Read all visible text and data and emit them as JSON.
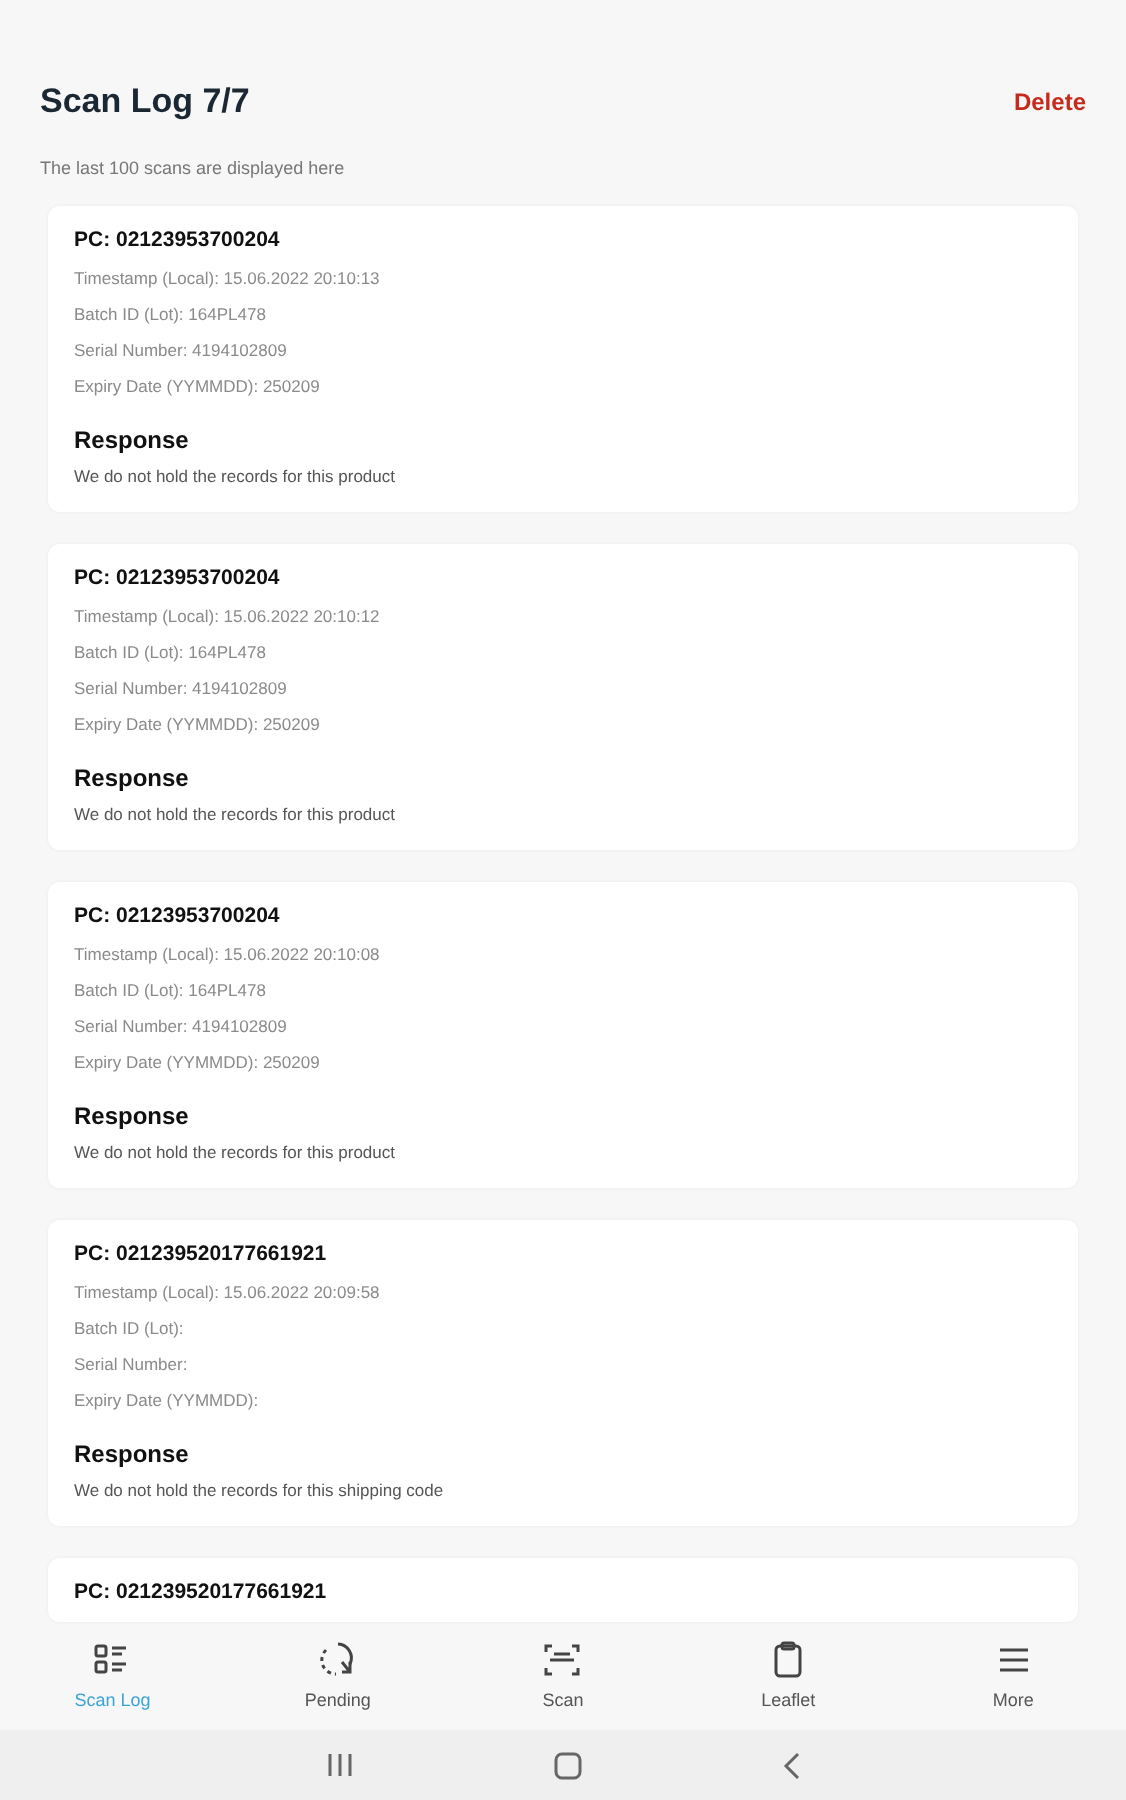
{
  "header": {
    "title": "Scan Log 7/7",
    "action": "Delete",
    "subtitle": "The last 100 scans are displayed here"
  },
  "scans": [
    {
      "pc": "PC: 02123953700204",
      "fields": [
        "Timestamp (Local): 15.06.2022 20:10:13",
        "Batch ID (Lot): 164PL478",
        "Serial Number: 4194102809",
        "Expiry Date (YYMMDD): 250209"
      ],
      "response_title": "Response",
      "response": "We do not hold the records for this product"
    },
    {
      "pc": "PC: 02123953700204",
      "fields": [
        "Timestamp (Local): 15.06.2022 20:10:12",
        "Batch ID (Lot): 164PL478",
        "Serial Number: 4194102809",
        "Expiry Date (YYMMDD): 250209"
      ],
      "response_title": "Response",
      "response": "We do not hold the records for this product"
    },
    {
      "pc": "PC: 02123953700204",
      "fields": [
        "Timestamp (Local): 15.06.2022 20:10:08",
        "Batch ID (Lot): 164PL478",
        "Serial Number: 4194102809",
        "Expiry Date (YYMMDD): 250209"
      ],
      "response_title": "Response",
      "response": "We do not hold the records for this product"
    },
    {
      "pc": "PC: 021239520177661921",
      "fields": [
        "Timestamp (Local): 15.06.2022 20:09:58",
        "Batch ID (Lot):",
        "Serial Number:",
        "Expiry Date (YYMMDD):"
      ],
      "response_title": "Response",
      "response": "We do not hold the records for this shipping code"
    },
    {
      "pc": "PC: 021239520177661921"
    }
  ],
  "bottom_nav": [
    {
      "kind": "list",
      "label": "Scan Log",
      "selected": true
    },
    {
      "kind": "pending",
      "label": "Pending",
      "selected": false
    },
    {
      "kind": "scan",
      "label": "Scan",
      "selected": false
    },
    {
      "kind": "clipboard",
      "label": "Leaflet",
      "selected": false
    },
    {
      "kind": "menu",
      "label": "More",
      "selected": false
    }
  ]
}
